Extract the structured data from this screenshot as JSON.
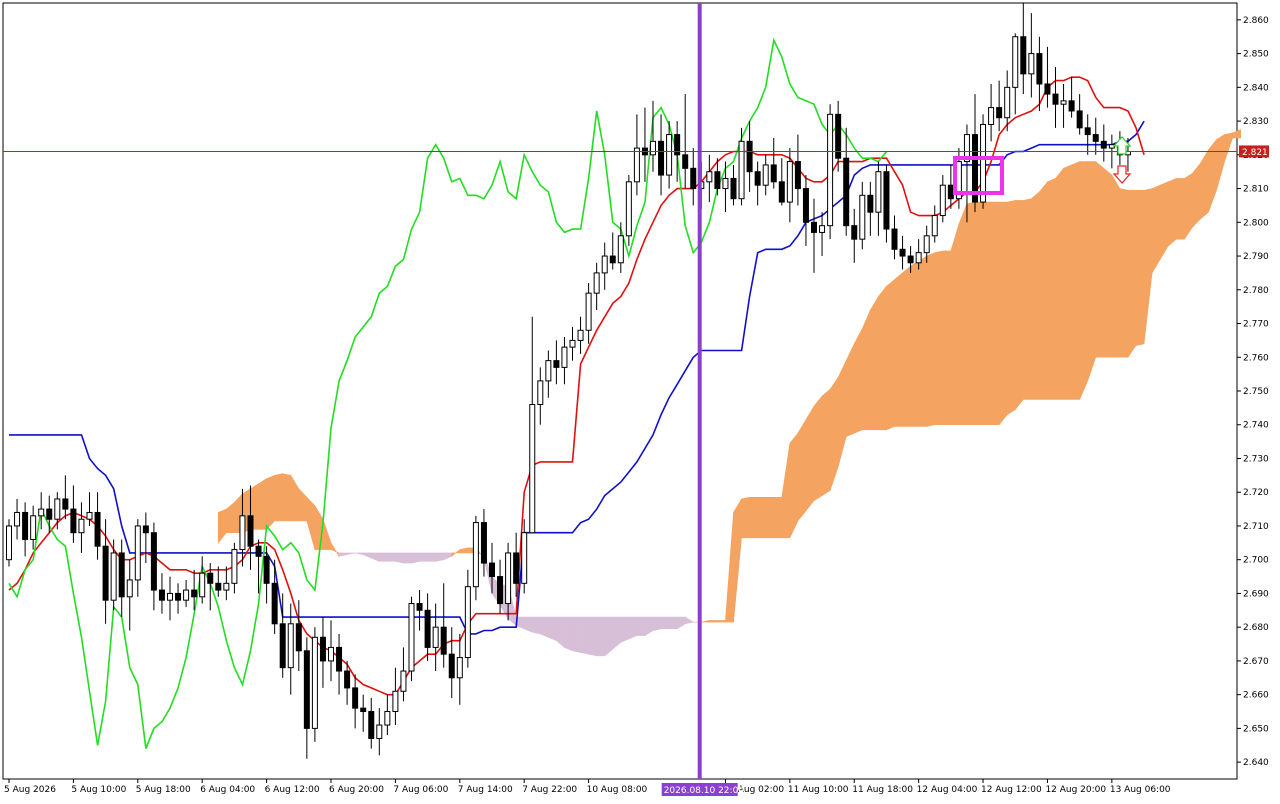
{
  "chart_data": {
    "type": "candlestick",
    "title": "",
    "indicator": "Ichimoku Kinko Hyo",
    "ylim": [
      2.635,
      2.865
    ],
    "y_ticks": [
      "2.640",
      "2.650",
      "2.660",
      "2.670",
      "2.680",
      "2.690",
      "2.700",
      "2.710",
      "2.720",
      "2.730",
      "2.740",
      "2.750",
      "2.760",
      "2.770",
      "2.780",
      "2.790",
      "2.800",
      "2.810",
      "2.820",
      "2.830",
      "2.840",
      "2.850",
      "2.860"
    ],
    "x_ticks": [
      {
        "i": 0,
        "label": "5 Aug 2026"
      },
      {
        "i": 8,
        "label": "5 Aug 10:00"
      },
      {
        "i": 16,
        "label": "5 Aug 18:00"
      },
      {
        "i": 24,
        "label": "6 Aug 04:00"
      },
      {
        "i": 32,
        "label": "6 Aug 12:00"
      },
      {
        "i": 40,
        "label": "6 Aug 20:00"
      },
      {
        "i": 48,
        "label": "7 Aug 06:00"
      },
      {
        "i": 56,
        "label": "7 Aug 14:00"
      },
      {
        "i": 64,
        "label": "7 Aug 22:00"
      },
      {
        "i": 72,
        "label": "10 Aug 08:00"
      },
      {
        "i": 89,
        "label": "11 Aug 02:00"
      },
      {
        "i": 97,
        "label": "11 Aug 10:00"
      },
      {
        "i": 105,
        "label": "11 Aug 18:00"
      },
      {
        "i": 113,
        "label": "12 Aug 04:00"
      },
      {
        "i": 121,
        "label": "12 Aug 12:00"
      },
      {
        "i": 129,
        "label": "12 Aug 20:00"
      },
      {
        "i": 137,
        "label": "13 Aug 06:00"
      }
    ],
    "x_bar_spacing_note": "",
    "vertical_marker": {
      "i": 85.8,
      "label": "2026.08.10 22:00",
      "color": "#8a3fd1"
    },
    "current_price": {
      "value": 2.821,
      "label": "2.821",
      "color": "#c81e1e"
    },
    "candles": [
      [
        2.7,
        2.712,
        2.698,
        2.71
      ],
      [
        2.71,
        2.718,
        2.706,
        2.714
      ],
      [
        2.714,
        2.717,
        2.701,
        2.706
      ],
      [
        2.706,
        2.716,
        2.703,
        2.713
      ],
      [
        2.713,
        2.72,
        2.709,
        2.715
      ],
      [
        2.715,
        2.719,
        2.708,
        2.712
      ],
      [
        2.712,
        2.72,
        2.709,
        2.718
      ],
      [
        2.718,
        2.725,
        2.712,
        2.715
      ],
      [
        2.715,
        2.722,
        2.705,
        2.708
      ],
      [
        2.708,
        2.717,
        2.702,
        2.712
      ],
      [
        2.712,
        2.72,
        2.71,
        2.714
      ],
      [
        2.714,
        2.72,
        2.7,
        2.704
      ],
      [
        2.704,
        2.712,
        2.681,
        2.688
      ],
      [
        2.688,
        2.706,
        2.685,
        2.702
      ],
      [
        2.702,
        2.706,
        2.683,
        2.689
      ],
      [
        2.689,
        2.7,
        2.679,
        2.694
      ],
      [
        2.694,
        2.712,
        2.689,
        2.71
      ],
      [
        2.71,
        2.714,
        2.699,
        2.708
      ],
      [
        2.708,
        2.711,
        2.685,
        2.691
      ],
      [
        2.691,
        2.696,
        2.684,
        2.688
      ],
      [
        2.688,
        2.695,
        2.682,
        2.69
      ],
      [
        2.69,
        2.693,
        2.684,
        2.688
      ],
      [
        2.688,
        2.694,
        2.686,
        2.691
      ],
      [
        2.691,
        2.697,
        2.685,
        2.689
      ],
      [
        2.689,
        2.701,
        2.687,
        2.696
      ],
      [
        2.696,
        2.699,
        2.685,
        2.693
      ],
      [
        2.693,
        2.698,
        2.689,
        2.691
      ],
      [
        2.691,
        2.698,
        2.688,
        2.693
      ],
      [
        2.693,
        2.705,
        2.69,
        2.703
      ],
      [
        2.703,
        2.721,
        2.698,
        2.713
      ],
      [
        2.713,
        2.722,
        2.697,
        2.704
      ],
      [
        2.704,
        2.706,
        2.69,
        2.701
      ],
      [
        2.701,
        2.704,
        2.687,
        2.693
      ],
      [
        2.693,
        2.7,
        2.678,
        2.681
      ],
      [
        2.681,
        2.69,
        2.665,
        2.668
      ],
      [
        2.668,
        2.687,
        2.66,
        2.681
      ],
      [
        2.681,
        2.688,
        2.667,
        2.673
      ],
      [
        2.673,
        2.677,
        2.641,
        2.65
      ],
      [
        2.65,
        2.68,
        2.646,
        2.677
      ],
      [
        2.677,
        2.683,
        2.662,
        2.67
      ],
      [
        2.67,
        2.682,
        2.664,
        2.674
      ],
      [
        2.674,
        2.678,
        2.66,
        2.667
      ],
      [
        2.667,
        2.67,
        2.657,
        2.662
      ],
      [
        2.662,
        2.666,
        2.65,
        2.656
      ],
      [
        2.656,
        2.66,
        2.649,
        2.655
      ],
      [
        2.655,
        2.659,
        2.644,
        2.647
      ],
      [
        2.647,
        2.656,
        2.642,
        2.651
      ],
      [
        2.651,
        2.66,
        2.648,
        2.655
      ],
      [
        2.655,
        2.668,
        2.651,
        2.661
      ],
      [
        2.661,
        2.674,
        2.658,
        2.667
      ],
      [
        2.667,
        2.689,
        2.664,
        2.687
      ],
      [
        2.687,
        2.691,
        2.679,
        2.685
      ],
      [
        2.685,
        2.69,
        2.67,
        2.674
      ],
      [
        2.674,
        2.687,
        2.667,
        2.68
      ],
      [
        2.68,
        2.693,
        2.668,
        2.672
      ],
      [
        2.672,
        2.68,
        2.659,
        2.665
      ],
      [
        2.665,
        2.678,
        2.657,
        2.671
      ],
      [
        2.671,
        2.697,
        2.668,
        2.692
      ],
      [
        2.692,
        2.713,
        2.688,
        2.711
      ],
      [
        2.711,
        2.715,
        2.695,
        2.699
      ],
      [
        2.699,
        2.705,
        2.69,
        2.695
      ],
      [
        2.695,
        2.7,
        2.684,
        2.687
      ],
      [
        2.687,
        2.705,
        2.682,
        2.702
      ],
      [
        2.702,
        2.708,
        2.689,
        2.693
      ],
      [
        2.693,
        2.712,
        2.69,
        2.708
      ],
      [
        2.708,
        2.772,
        2.732,
        2.746
      ],
      [
        2.746,
        2.757,
        2.74,
        2.753
      ],
      [
        2.753,
        2.762,
        2.748,
        2.759
      ],
      [
        2.759,
        2.765,
        2.752,
        2.757
      ],
      [
        2.757,
        2.766,
        2.752,
        2.763
      ],
      [
        2.763,
        2.769,
        2.759,
        2.765
      ],
      [
        2.765,
        2.772,
        2.761,
        2.768
      ],
      [
        2.768,
        2.782,
        2.764,
        2.779
      ],
      [
        2.779,
        2.788,
        2.774,
        2.785
      ],
      [
        2.785,
        2.794,
        2.78,
        2.79
      ],
      [
        2.79,
        2.797,
        2.786,
        2.788
      ],
      [
        2.788,
        2.8,
        2.785,
        2.796
      ],
      [
        2.796,
        2.814,
        2.793,
        2.812
      ],
      [
        2.812,
        2.832,
        2.808,
        2.822
      ],
      [
        2.822,
        2.834,
        2.812,
        2.82
      ],
      [
        2.82,
        2.836,
        2.815,
        2.824
      ],
      [
        2.824,
        2.832,
        2.808,
        2.814
      ],
      [
        2.814,
        2.83,
        2.81,
        2.826
      ],
      [
        2.826,
        2.83,
        2.812,
        2.82
      ],
      [
        2.82,
        2.838,
        2.81,
        2.816
      ],
      [
        2.816,
        2.822,
        2.805,
        2.81
      ],
      [
        2.81,
        2.818,
        2.804,
        2.812
      ],
      [
        2.812,
        2.82,
        2.806,
        2.815
      ],
      [
        2.815,
        2.819,
        2.808,
        2.81
      ],
      [
        2.81,
        2.818,
        2.803,
        2.813
      ],
      [
        2.813,
        2.817,
        2.805,
        2.807
      ],
      [
        2.807,
        2.828,
        2.805,
        2.824
      ],
      [
        2.824,
        2.83,
        2.809,
        2.815
      ],
      [
        2.815,
        2.818,
        2.805,
        2.811
      ],
      [
        2.811,
        2.82,
        2.808,
        2.817
      ],
      [
        2.817,
        2.825,
        2.81,
        2.812
      ],
      [
        2.812,
        2.819,
        2.805,
        2.806
      ],
      [
        2.806,
        2.822,
        2.8,
        2.818
      ],
      [
        2.818,
        2.826,
        2.805,
        2.81
      ],
      [
        2.81,
        2.814,
        2.793,
        2.8
      ],
      [
        2.8,
        2.807,
        2.785,
        2.797
      ],
      [
        2.797,
        2.803,
        2.79,
        2.799
      ],
      [
        2.799,
        2.835,
        2.795,
        2.832
      ],
      [
        2.832,
        2.836,
        2.815,
        2.819
      ],
      [
        2.819,
        2.828,
        2.796,
        2.799
      ],
      [
        2.799,
        2.804,
        2.788,
        2.795
      ],
      [
        2.795,
        2.812,
        2.792,
        2.808
      ],
      [
        2.808,
        2.812,
        2.796,
        2.803
      ],
      [
        2.803,
        2.818,
        2.796,
        2.815
      ],
      [
        2.815,
        2.817,
        2.794,
        2.798
      ],
      [
        2.798,
        2.802,
        2.789,
        2.792
      ],
      [
        2.792,
        2.796,
        2.786,
        2.79
      ],
      [
        2.79,
        2.793,
        2.785,
        2.788
      ],
      [
        2.788,
        2.795,
        2.786,
        2.791
      ],
      [
        2.791,
        2.799,
        2.788,
        2.796
      ],
      [
        2.796,
        2.805,
        2.794,
        2.802
      ],
      [
        2.802,
        2.814,
        2.8,
        2.811
      ],
      [
        2.811,
        2.817,
        2.804,
        2.807
      ],
      [
        2.807,
        2.822,
        2.804,
        2.818
      ],
      [
        2.818,
        2.829,
        2.8,
        2.826
      ],
      [
        2.826,
        2.838,
        2.803,
        2.806
      ],
      [
        2.806,
        2.832,
        2.804,
        2.829
      ],
      [
        2.829,
        2.841,
        2.824,
        2.834
      ],
      [
        2.834,
        2.842,
        2.827,
        2.831
      ],
      [
        2.831,
        2.845,
        2.827,
        2.84
      ],
      [
        2.84,
        2.856,
        2.832,
        2.855
      ],
      [
        2.855,
        2.865,
        2.838,
        2.844
      ],
      [
        2.844,
        2.862,
        2.837,
        2.85
      ],
      [
        2.85,
        2.855,
        2.833,
        2.841
      ],
      [
        2.841,
        2.852,
        2.834,
        2.838
      ],
      [
        2.838,
        2.846,
        2.828,
        2.835
      ],
      [
        2.835,
        2.841,
        2.828,
        2.836
      ],
      [
        2.836,
        2.843,
        2.831,
        2.833
      ],
      [
        2.833,
        2.838,
        2.826,
        2.828
      ],
      [
        2.828,
        2.832,
        2.82,
        2.826
      ],
      [
        2.826,
        2.831,
        2.82,
        2.824
      ],
      [
        2.824,
        2.829,
        2.818,
        2.822
      ],
      [
        2.822,
        2.826,
        2.816,
        2.823
      ],
      [
        2.823,
        2.827,
        2.817,
        2.82
      ],
      [
        2.82,
        2.825,
        2.815,
        2.821
      ]
    ],
    "tenkan_sen": [
      2.691,
      2.693,
      2.697,
      2.702,
      2.705,
      2.708,
      2.711,
      2.713,
      2.714,
      2.713,
      2.712,
      2.71,
      2.707,
      2.703,
      2.7,
      2.7,
      2.701,
      2.702,
      2.701,
      2.699,
      2.697,
      2.697,
      2.697,
      2.696,
      2.696,
      2.697,
      2.697,
      2.697,
      2.698,
      2.7,
      2.704,
      2.705,
      2.705,
      2.703,
      2.697,
      2.69,
      2.682,
      2.678,
      2.676,
      2.674,
      2.673,
      2.671,
      2.669,
      2.665,
      2.663,
      2.662,
      2.661,
      2.66,
      2.66,
      2.664,
      2.668,
      2.67,
      2.672,
      2.672,
      2.675,
      2.676,
      2.676,
      2.681,
      2.684,
      2.684,
      2.684,
      2.684,
      2.684,
      2.684,
      2.72,
      2.728,
      2.729,
      2.729,
      2.729,
      2.729,
      2.729,
      2.758,
      2.763,
      2.768,
      2.772,
      2.776,
      2.778,
      2.782,
      2.789,
      2.795,
      2.8,
      2.805,
      2.808,
      2.81,
      2.81,
      2.81,
      2.812,
      2.815,
      2.818,
      2.82,
      2.821,
      2.821,
      2.821,
      2.82,
      2.82,
      2.82,
      2.82,
      2.819,
      2.816,
      2.813,
      2.812,
      2.812,
      2.814,
      2.818,
      2.818,
      2.818,
      2.818,
      2.819,
      2.819,
      2.819,
      2.815,
      2.811,
      2.803,
      2.802,
      2.802,
      2.802,
      2.803,
      2.805,
      2.807,
      2.809,
      2.809,
      2.812,
      2.818,
      2.826,
      2.829,
      2.831,
      2.832,
      2.833,
      2.835,
      2.84,
      2.842,
      2.842,
      2.843,
      2.843,
      2.842,
      2.837,
      2.834,
      2.834,
      2.834,
      2.833,
      2.828,
      2.82
    ],
    "kijun_sen": [
      2.737,
      2.737,
      2.737,
      2.737,
      2.737,
      2.737,
      2.737,
      2.737,
      2.737,
      2.737,
      2.73,
      2.727,
      2.725,
      2.721,
      2.71,
      2.702,
      2.702,
      2.702,
      2.702,
      2.702,
      2.702,
      2.702,
      2.702,
      2.702,
      2.702,
      2.702,
      2.702,
      2.702,
      2.702,
      2.702,
      2.702,
      2.702,
      2.702,
      2.698,
      2.683,
      2.683,
      2.683,
      2.683,
      2.683,
      2.683,
      2.683,
      2.683,
      2.683,
      2.683,
      2.683,
      2.683,
      2.683,
      2.683,
      2.683,
      2.683,
      2.683,
      2.683,
      2.683,
      2.683,
      2.683,
      2.683,
      2.683,
      2.678,
      2.678,
      2.679,
      2.679,
      2.68,
      2.68,
      2.68,
      2.708,
      2.708,
      2.708,
      2.708,
      2.708,
      2.708,
      2.708,
      2.711,
      2.712,
      2.715,
      2.719,
      2.721,
      2.723,
      2.726,
      2.729,
      2.733,
      2.737,
      2.743,
      2.748,
      2.752,
      2.756,
      2.76,
      2.762,
      2.762,
      2.762,
      2.762,
      2.762,
      2.762,
      2.778,
      2.791,
      2.792,
      2.792,
      2.792,
      2.793,
      2.796,
      2.8,
      2.801,
      2.802,
      2.804,
      2.806,
      2.808,
      2.814,
      2.816,
      2.817,
      2.817,
      2.817,
      2.817,
      2.817,
      2.817,
      2.817,
      2.817,
      2.817,
      2.817,
      2.817,
      2.817,
      2.817,
      2.817,
      2.817,
      2.817,
      2.817,
      2.82,
      2.821,
      2.821,
      2.822,
      2.823,
      2.823,
      2.823,
      2.823,
      2.823,
      2.823,
      2.823,
      2.823,
      2.823,
      2.823,
      2.824,
      2.824,
      2.826,
      2.83
    ],
    "chikou_span": [
      2.693,
      2.689,
      2.697,
      2.7,
      2.715,
      2.71,
      2.706,
      2.704,
      2.69,
      2.677,
      2.661,
      2.645,
      2.658,
      2.686,
      2.683,
      2.668,
      2.663,
      2.644,
      2.65,
      2.652,
      2.656,
      2.662,
      2.671,
      2.684,
      2.698,
      2.693,
      2.686,
      2.676,
      2.668,
      2.663,
      2.673,
      2.687,
      2.71,
      2.707,
      2.703,
      2.705,
      2.702,
      2.694,
      2.691,
      2.711,
      2.739,
      2.753,
      2.759,
      2.766,
      2.769,
      2.772,
      2.779,
      2.781,
      2.787,
      2.789,
      2.798,
      2.803,
      2.819,
      2.823,
      2.819,
      2.812,
      2.813,
      2.808,
      2.808,
      2.807,
      2.811,
      2.818,
      2.809,
      2.807,
      2.82,
      2.815,
      2.811,
      2.809,
      2.8,
      2.797,
      2.798,
      2.798,
      2.813,
      2.833,
      2.82,
      2.8,
      2.798,
      2.79,
      2.799,
      2.806,
      2.831,
      2.834,
      2.829,
      2.82,
      2.799,
      2.791,
      2.794,
      2.8,
      2.81,
      2.816,
      2.818,
      2.825,
      2.83,
      2.834,
      2.84,
      2.854,
      2.849,
      2.841,
      2.837,
      2.836,
      2.835,
      2.829,
      2.826,
      2.829,
      2.826,
      2.822,
      2.819,
      2.819,
      2.818,
      2.821
    ]
  }
}
